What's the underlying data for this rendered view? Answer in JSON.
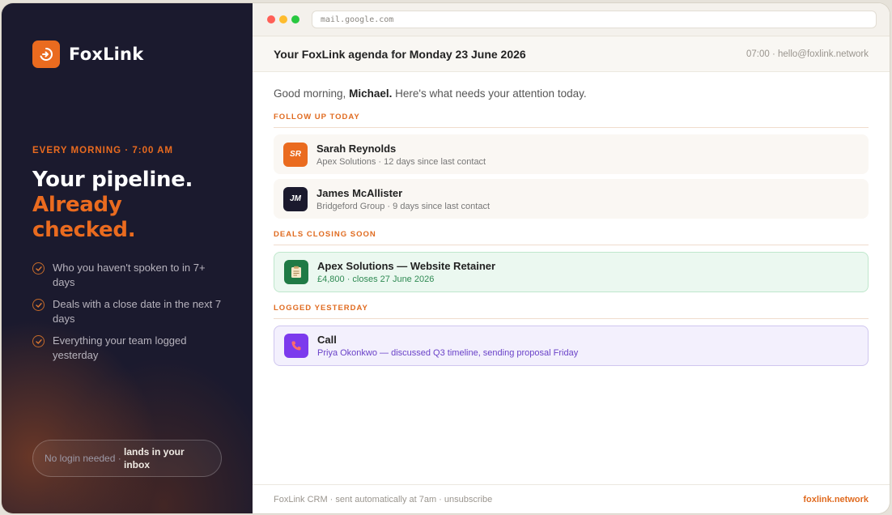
{
  "brand": {
    "name": "FoxLink",
    "logo_icon": "arrow-circle-icon",
    "accent": "#ea6b1f"
  },
  "promo": {
    "eyebrow": "EVERY MORNING · 7:00 AM",
    "headline_line1": "Your pipeline.",
    "headline_line2": "Already",
    "headline_line3": "checked.",
    "checklist": [
      {
        "text": "Who you haven't spoken to in 7+ days"
      },
      {
        "text": "Deals with a close date in the next 7 days"
      },
      {
        "text": "Everything your team logged yesterday"
      }
    ],
    "pill_left": "No login needed ·",
    "pill_right": "lands in your inbox"
  },
  "browser": {
    "url": "mail.google.com"
  },
  "email": {
    "subject": "Your FoxLink agenda for Monday 23 June 2026",
    "meta": "07:00 · hello@foxlink.network",
    "greeting_prefix": "Good morning,",
    "greeting_name": "Michael.",
    "greeting_suffix": "Here's what needs your attention today.",
    "sections": {
      "follow_up": {
        "title": "FOLLOW UP TODAY",
        "items": [
          {
            "initials": "SR",
            "name": "Sarah Reynolds",
            "sub": "Apex Solutions · 12 days since last contact",
            "color": "#ea6b1f"
          },
          {
            "initials": "JM",
            "name": "James McAllister",
            "sub": "Bridgeford Group · 9 days since last contact",
            "color": "#1b1a2e"
          }
        ]
      },
      "deals": {
        "title": "DEALS CLOSING SOON",
        "items": [
          {
            "icon": "clipboard-icon",
            "name": "Apex Solutions — Website Retainer",
            "sub": "£4,800 · closes 27 June 2026",
            "color": "#1f7a45"
          }
        ]
      },
      "logged": {
        "title": "LOGGED YESTERDAY",
        "items": [
          {
            "icon": "phone-icon",
            "name": "Call",
            "sub": "Priya Okonkwo — discussed Q3 timeline, sending proposal Friday",
            "color": "#7c3aed"
          }
        ]
      }
    },
    "footer_left": "FoxLink CRM · sent automatically at 7am · unsubscribe",
    "footer_right": "foxlink.network"
  }
}
